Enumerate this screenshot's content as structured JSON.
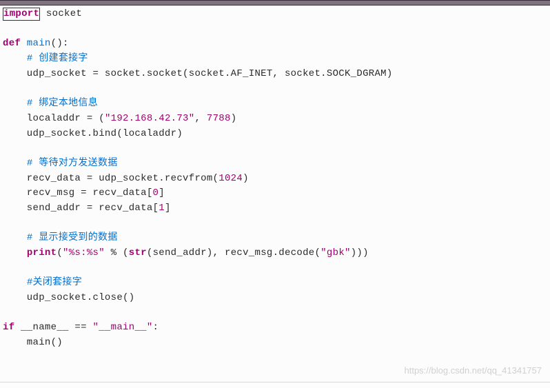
{
  "code": {
    "l1_import": "import",
    "l1_module": " socket",
    "l3_def": "def",
    "l3_name": " main",
    "l3_paren": "():",
    "c1": "# 创建套接字",
    "l5": "    udp_socket = socket.socket(socket.AF_INET, socket.SOCK_DGRAM)",
    "c2": "# 绑定本地信息",
    "l8a": "    localaddr = (",
    "l8_str": "\"192.168.42.73\"",
    "l8b": ", ",
    "l8_num": "7788",
    "l8c": ")",
    "l9": "    udp_socket.bind(localaddr)",
    "c3": "# 等待对方发送数据",
    "l12a": "    recv_data = udp_socket.recvfrom(",
    "l12_num": "1024",
    "l12b": ")",
    "l13a": "    recv_msg = recv_data[",
    "l13_num": "0",
    "l13b": "]",
    "l14a": "    send_addr = recv_data[",
    "l14_num": "1",
    "l14b": "]",
    "c4": "# 显示接受到的数据",
    "l17_print": "print",
    "l17a": "(",
    "l17_fmt": "\"%s:%s\"",
    "l17b": " % (",
    "l17_str": "str",
    "l17c": "(send_addr), recv_msg.decode(",
    "l17_gbk": "\"gbk\"",
    "l17d": ")))",
    "c5": "#关闭套接字",
    "l20": "    udp_socket.close()",
    "l22_if": "if",
    "l22a": " __name__ == ",
    "l22_str": "\"__main__\"",
    "l22b": ":",
    "l23": "    main()"
  },
  "watermark": "https://blog.csdn.net/qq_41341757"
}
